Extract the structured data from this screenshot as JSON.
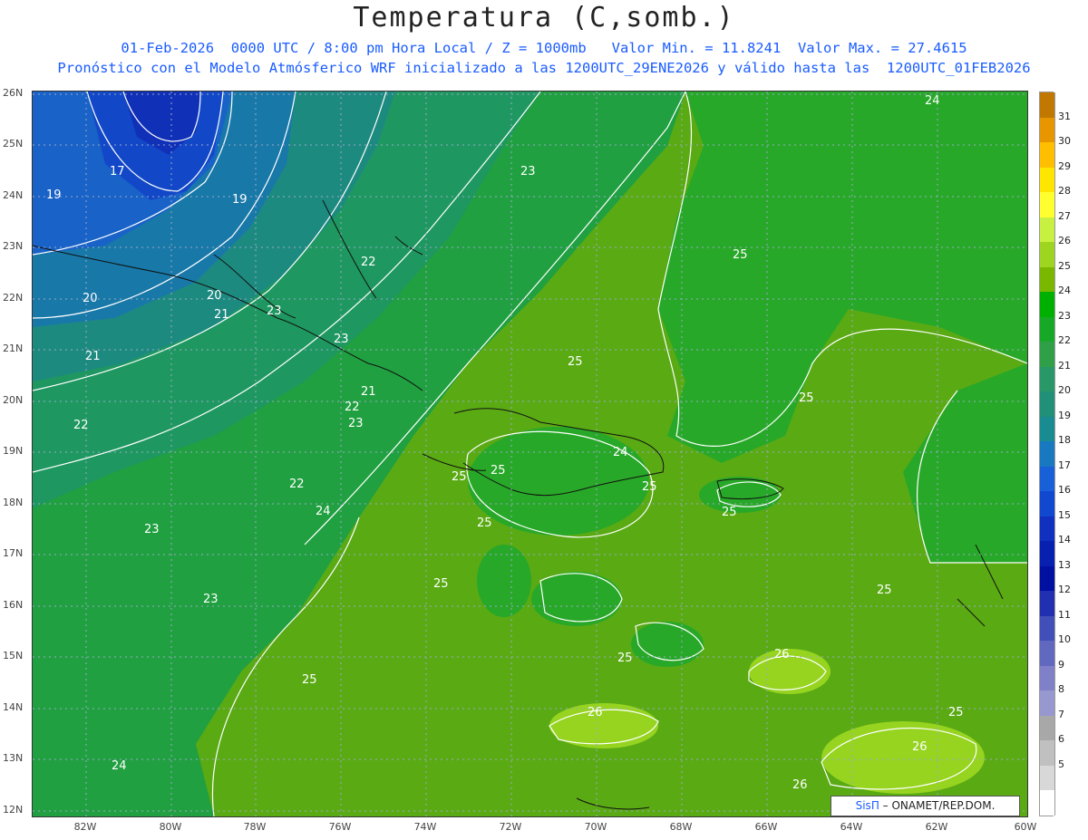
{
  "title": "Temperatura (C,somb.)",
  "subtitle_1": "01-Feb-2026  0000 UTC / 8:00 pm Hora Local / Z = 1000mb   Valor Min. = 11.8241  Valor Max. = 27.4615",
  "subtitle_2": "Pronóstico con el Modelo Atmósferico WRF inicializado a las 1200UTC_29ENE2026 y válido hasta las  1200UTC_01FEB2026",
  "y_ticks": [
    "26N",
    "25N",
    "24N",
    "23N",
    "22N",
    "21N",
    "20N",
    "19N",
    "18N",
    "17N",
    "16N",
    "15N",
    "14N",
    "13N",
    "12N"
  ],
  "x_ticks": [
    "82W",
    "80W",
    "78W",
    "76W",
    "74W",
    "72W",
    "70W",
    "68W",
    "66W",
    "64W",
    "62W",
    "60W"
  ],
  "colorbar": {
    "labels": [
      "31",
      "30",
      "29",
      "28",
      "27",
      "26",
      "25",
      "24",
      "23",
      "22",
      "21",
      "20",
      "19",
      "18",
      "17",
      "16",
      "15",
      "14",
      "13",
      "12",
      "11",
      "10",
      "9",
      "8",
      "7",
      "6",
      "5"
    ],
    "colors": [
      "#c07800",
      "#e89600",
      "#ffbe00",
      "#ffe600",
      "#ffff30",
      "#c8f040",
      "#9ed520",
      "#7ab800",
      "#00b000",
      "#18a828",
      "#30a048",
      "#289868",
      "#209078",
      "#188c90",
      "#1878c0",
      "#1860d8",
      "#1048d0",
      "#1030c0",
      "#0820b0",
      "#0010a0",
      "#2030b0",
      "#4050b8",
      "#6068c0",
      "#8080c8",
      "#9898d0",
      "#a8a8a8",
      "#c0c0c0",
      "#d8d8d8",
      "#ffffff"
    ]
  },
  "contour_labels": [
    "17",
    "19",
    "19",
    "20",
    "20",
    "21",
    "21",
    "21",
    "22",
    "22",
    "22",
    "22",
    "23",
    "23",
    "23",
    "23",
    "23",
    "23",
    "24",
    "24",
    "24",
    "24",
    "25",
    "25",
    "25",
    "25",
    "25",
    "25",
    "25",
    "25",
    "25",
    "25",
    "25",
    "25",
    "25",
    "26",
    "26",
    "26",
    "26"
  ],
  "credit": {
    "brand": "SisΠ",
    "text": "– ONAMET/REP.DOM."
  }
}
